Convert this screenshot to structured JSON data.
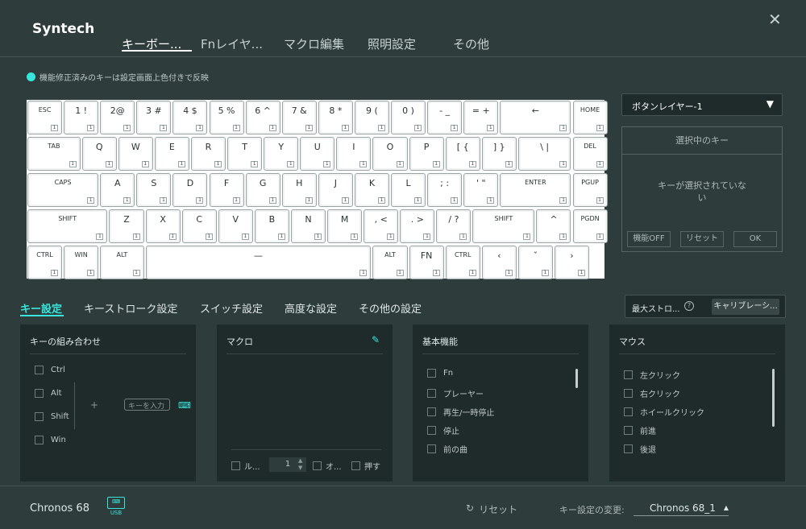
{
  "header": {
    "brand": "Syntech",
    "tabs": [
      "キーボー...",
      "Fnレイヤ...",
      "マクロ編集",
      "照明設定",
      "その他"
    ],
    "close": "✕"
  },
  "notice": "機能修正済みのキーは設定画面上色付きで反映",
  "keyboard": {
    "layer_badge": "1",
    "rows": [
      [
        "ESC",
        "1 !",
        "2@",
        "3 #",
        "4 $",
        "5 %",
        "6 ^",
        "7 &",
        "8 *",
        "9 (",
        "0 )",
        "- _",
        "= +",
        "←",
        "HOME"
      ],
      [
        "TAB",
        "Q",
        "W",
        "E",
        "R",
        "T",
        "Y",
        "U",
        "I",
        "O",
        "P",
        "[ {",
        "] }",
        "\\ |",
        "DEL"
      ],
      [
        "CAPS",
        "A",
        "S",
        "D",
        "F",
        "G",
        "H",
        "J",
        "K",
        "L",
        "; :",
        "' \"",
        "ENTER",
        "PGUP"
      ],
      [
        "SHIFT",
        "Z",
        "X",
        "C",
        "V",
        "B",
        "N",
        "M",
        ", <",
        ". >",
        "/ ?",
        "SHIFT",
        "^",
        "PGDN"
      ],
      [
        "CTRL",
        "WIN",
        "ALT",
        "—",
        "ALT",
        "FN",
        "CTRL",
        "‹",
        "ˇ",
        "›"
      ]
    ]
  },
  "right": {
    "layer_select": "ボタンレイヤー-1",
    "selected_title": "選択中のキー",
    "selected_empty": "キーが選択されていない",
    "btn_func_off": "機能OFF",
    "btn_reset": "リセット",
    "btn_ok": "OK"
  },
  "subtabs": [
    "キー設定",
    "キーストローク設定",
    "スイッチ設定",
    "高度な設定",
    "その他の設定"
  ],
  "stroke": {
    "label": "最大ストロ...",
    "help": "?",
    "calibrate": "キャリブレーシ..."
  },
  "combo": {
    "title": "キーの組み合わせ",
    "items": [
      "Ctrl",
      "Alt",
      "Shift",
      "Win"
    ],
    "plus": "+",
    "input_placeholder": "キーを入力",
    "keyboard_icon": "⌨"
  },
  "macro": {
    "title": "マクロ",
    "edit_icon": "✎",
    "loop_label": "ル...",
    "loop_value": "1",
    "option_label": "オ...",
    "press_label": "押す"
  },
  "basic": {
    "title": "基本機能",
    "items": [
      "Fn",
      "プレーヤー",
      "再生/一時停止",
      "停止",
      "前の曲"
    ]
  },
  "mouse": {
    "title": "マウス",
    "items": [
      "左クリック",
      "右クリック",
      "ホイールクリック",
      "前進",
      "後退"
    ]
  },
  "footer": {
    "model": "Chronos 68",
    "usb": "USB",
    "reset_icon": "↻",
    "reset": "リセット",
    "change_label": "キー設定の変更:",
    "profile": "Chronos 68_1",
    "profile_arrow": "▲"
  }
}
